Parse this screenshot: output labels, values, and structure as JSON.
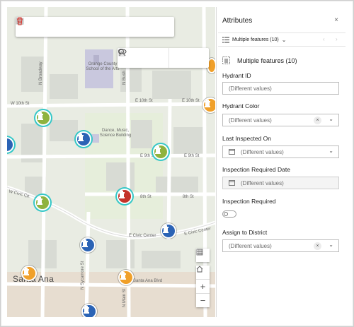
{
  "map": {
    "street_labels": {
      "w10th": "W 10th St",
      "e10th_a": "E 10th St",
      "e10th_b": "E 10th St",
      "e9th_a": "E 9th St",
      "e9th_b": "E 9th St",
      "e8th_a": "8th St",
      "e8th_b": "8th St",
      "wcivic": "W Civic Ce",
      "ecivic_a": "E Civic Center",
      "ecivic_b": "E Civic Center",
      "santaana_blvd": "Santa Ana Blvd",
      "nbroadway": "N Broadway",
      "nbush": "N Bush",
      "nsycamore": "N Sycamore St",
      "nmain": "N Main St"
    },
    "poi_labels": {
      "orange_county": "Orange County School of the Arts",
      "dance": "Dance, Music, Science Building"
    },
    "city_label": "Santa Ana",
    "hydrant_colors": {
      "orange": "#f0a02a",
      "green": "#8fb33e",
      "blue": "#2b63b5",
      "red": "#c4332a",
      "selected_ring": "#35c7c7"
    },
    "edit_toolbar_icons": [
      "add-point-icon",
      "align-icon",
      "move-icon",
      "reshape-icon",
      "split-icon",
      "merge-icon",
      "copy-icon",
      "delete-icon"
    ],
    "select_toolbar_icons": [
      "clipboard-icon",
      "paste-icon",
      "dropdown-icon",
      "lasso-select-icon",
      "search-icon"
    ],
    "zoom_controls": [
      "basemap-gallery-icon",
      "home-icon",
      "zoom-in-icon",
      "zoom-out-icon"
    ],
    "zoom_in_label": "+",
    "zoom_out_label": "−"
  },
  "panel": {
    "title": "Attributes",
    "close_label": "×",
    "header": {
      "selector_label": "Multiple features (10)",
      "prev_label": "‹",
      "next_label": "›"
    },
    "feature_label": "Multiple features (10)",
    "fields": [
      {
        "label": "Hydrant ID",
        "value": "(Different values)"
      },
      {
        "label": "Hydrant Color",
        "value": "(Different values)"
      },
      {
        "label": "Last Inspected On",
        "value": "(Different values)"
      },
      {
        "label": "Inspection Required Date",
        "value": "(Different values)"
      },
      {
        "label": "Inspection Required",
        "value": ""
      },
      {
        "label": "Assign to District",
        "value": "(Different values)"
      }
    ]
  }
}
